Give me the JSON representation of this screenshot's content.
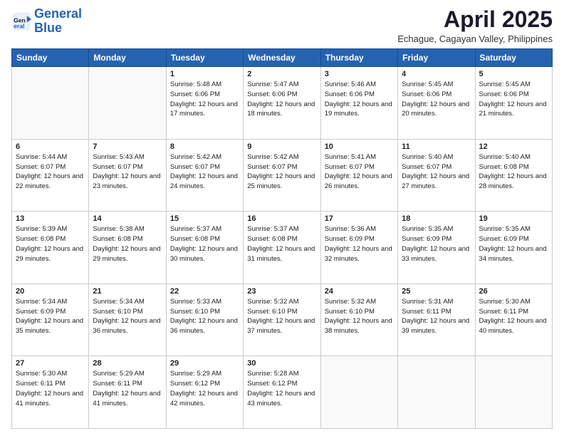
{
  "header": {
    "logo_line1": "General",
    "logo_line2": "Blue",
    "month": "April 2025",
    "location": "Echague, Cagayan Valley, Philippines"
  },
  "weekdays": [
    "Sunday",
    "Monday",
    "Tuesday",
    "Wednesday",
    "Thursday",
    "Friday",
    "Saturday"
  ],
  "weeks": [
    [
      {
        "day": "",
        "info": ""
      },
      {
        "day": "",
        "info": ""
      },
      {
        "day": "1",
        "info": "Sunrise: 5:48 AM\nSunset: 6:06 PM\nDaylight: 12 hours and 17 minutes."
      },
      {
        "day": "2",
        "info": "Sunrise: 5:47 AM\nSunset: 6:06 PM\nDaylight: 12 hours and 18 minutes."
      },
      {
        "day": "3",
        "info": "Sunrise: 5:46 AM\nSunset: 6:06 PM\nDaylight: 12 hours and 19 minutes."
      },
      {
        "day": "4",
        "info": "Sunrise: 5:45 AM\nSunset: 6:06 PM\nDaylight: 12 hours and 20 minutes."
      },
      {
        "day": "5",
        "info": "Sunrise: 5:45 AM\nSunset: 6:06 PM\nDaylight: 12 hours and 21 minutes."
      }
    ],
    [
      {
        "day": "6",
        "info": "Sunrise: 5:44 AM\nSunset: 6:07 PM\nDaylight: 12 hours and 22 minutes."
      },
      {
        "day": "7",
        "info": "Sunrise: 5:43 AM\nSunset: 6:07 PM\nDaylight: 12 hours and 23 minutes."
      },
      {
        "day": "8",
        "info": "Sunrise: 5:42 AM\nSunset: 6:07 PM\nDaylight: 12 hours and 24 minutes."
      },
      {
        "day": "9",
        "info": "Sunrise: 5:42 AM\nSunset: 6:07 PM\nDaylight: 12 hours and 25 minutes."
      },
      {
        "day": "10",
        "info": "Sunrise: 5:41 AM\nSunset: 6:07 PM\nDaylight: 12 hours and 26 minutes."
      },
      {
        "day": "11",
        "info": "Sunrise: 5:40 AM\nSunset: 6:07 PM\nDaylight: 12 hours and 27 minutes."
      },
      {
        "day": "12",
        "info": "Sunrise: 5:40 AM\nSunset: 6:08 PM\nDaylight: 12 hours and 28 minutes."
      }
    ],
    [
      {
        "day": "13",
        "info": "Sunrise: 5:39 AM\nSunset: 6:08 PM\nDaylight: 12 hours and 29 minutes."
      },
      {
        "day": "14",
        "info": "Sunrise: 5:38 AM\nSunset: 6:08 PM\nDaylight: 12 hours and 29 minutes."
      },
      {
        "day": "15",
        "info": "Sunrise: 5:37 AM\nSunset: 6:08 PM\nDaylight: 12 hours and 30 minutes."
      },
      {
        "day": "16",
        "info": "Sunrise: 5:37 AM\nSunset: 6:08 PM\nDaylight: 12 hours and 31 minutes."
      },
      {
        "day": "17",
        "info": "Sunrise: 5:36 AM\nSunset: 6:09 PM\nDaylight: 12 hours and 32 minutes."
      },
      {
        "day": "18",
        "info": "Sunrise: 5:35 AM\nSunset: 6:09 PM\nDaylight: 12 hours and 33 minutes."
      },
      {
        "day": "19",
        "info": "Sunrise: 5:35 AM\nSunset: 6:09 PM\nDaylight: 12 hours and 34 minutes."
      }
    ],
    [
      {
        "day": "20",
        "info": "Sunrise: 5:34 AM\nSunset: 6:09 PM\nDaylight: 12 hours and 35 minutes."
      },
      {
        "day": "21",
        "info": "Sunrise: 5:34 AM\nSunset: 6:10 PM\nDaylight: 12 hours and 36 minutes."
      },
      {
        "day": "22",
        "info": "Sunrise: 5:33 AM\nSunset: 6:10 PM\nDaylight: 12 hours and 36 minutes."
      },
      {
        "day": "23",
        "info": "Sunrise: 5:32 AM\nSunset: 6:10 PM\nDaylight: 12 hours and 37 minutes."
      },
      {
        "day": "24",
        "info": "Sunrise: 5:32 AM\nSunset: 6:10 PM\nDaylight: 12 hours and 38 minutes."
      },
      {
        "day": "25",
        "info": "Sunrise: 5:31 AM\nSunset: 6:11 PM\nDaylight: 12 hours and 39 minutes."
      },
      {
        "day": "26",
        "info": "Sunrise: 5:30 AM\nSunset: 6:11 PM\nDaylight: 12 hours and 40 minutes."
      }
    ],
    [
      {
        "day": "27",
        "info": "Sunrise: 5:30 AM\nSunset: 6:11 PM\nDaylight: 12 hours and 41 minutes."
      },
      {
        "day": "28",
        "info": "Sunrise: 5:29 AM\nSunset: 6:11 PM\nDaylight: 12 hours and 41 minutes."
      },
      {
        "day": "29",
        "info": "Sunrise: 5:29 AM\nSunset: 6:12 PM\nDaylight: 12 hours and 42 minutes."
      },
      {
        "day": "30",
        "info": "Sunrise: 5:28 AM\nSunset: 6:12 PM\nDaylight: 12 hours and 43 minutes."
      },
      {
        "day": "",
        "info": ""
      },
      {
        "day": "",
        "info": ""
      },
      {
        "day": "",
        "info": ""
      }
    ]
  ]
}
